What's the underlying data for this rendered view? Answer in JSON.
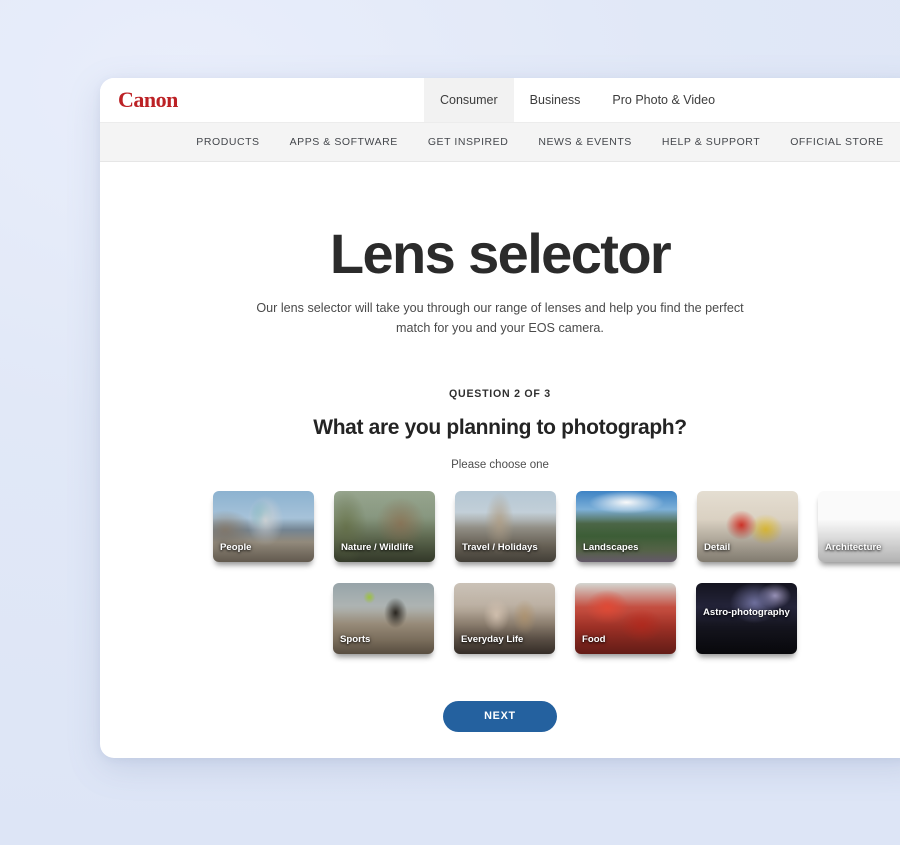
{
  "theme": {
    "page_background": "#e3e9f8",
    "brand_red": "#bc2125",
    "accent_blue": "#24619f",
    "selected_ring": "#5b93c4"
  },
  "header": {
    "logo_text": "Canon",
    "audience_tabs": [
      {
        "label": "Consumer",
        "active": true
      },
      {
        "label": "Business",
        "active": false
      },
      {
        "label": "Pro Photo & Video",
        "active": false
      }
    ],
    "nav_items": [
      {
        "label": "PRODUCTS"
      },
      {
        "label": "APPS & SOFTWARE"
      },
      {
        "label": "GET INSPIRED"
      },
      {
        "label": "NEWS & EVENTS"
      },
      {
        "label": "HELP & SUPPORT"
      },
      {
        "label": "OFFICIAL STORE"
      }
    ]
  },
  "hero": {
    "title": "Lens selector",
    "subtitle": "Our lens selector will take you through our range of lenses and help you find the perfect match for you and your EOS camera."
  },
  "quiz": {
    "counter": "QUESTION 2 OF 3",
    "question": "What are you planning to photograph?",
    "hint": "Please choose one",
    "row1": [
      {
        "label": "People",
        "art": "art-people",
        "selected": false
      },
      {
        "label": "Nature / Wildlife",
        "art": "art-nature",
        "selected": false
      },
      {
        "label": "Travel / Holidays",
        "art": "art-travel",
        "selected": false
      },
      {
        "label": "Landscapes",
        "art": "art-landscapes",
        "selected": false
      },
      {
        "label": "Detail",
        "art": "art-detail",
        "selected": false
      },
      {
        "label": "Architecture",
        "art": "art-architecture",
        "selected": false
      }
    ],
    "row2": [
      {
        "label": "Sports",
        "art": "art-sports",
        "selected": false
      },
      {
        "label": "Everyday Life",
        "art": "art-everyday",
        "selected": true
      },
      {
        "label": "Food",
        "art": "art-food",
        "selected": false
      },
      {
        "label": "Astro-photography",
        "art": "art-astro",
        "selected": false
      }
    ],
    "next_label": "NEXT"
  }
}
